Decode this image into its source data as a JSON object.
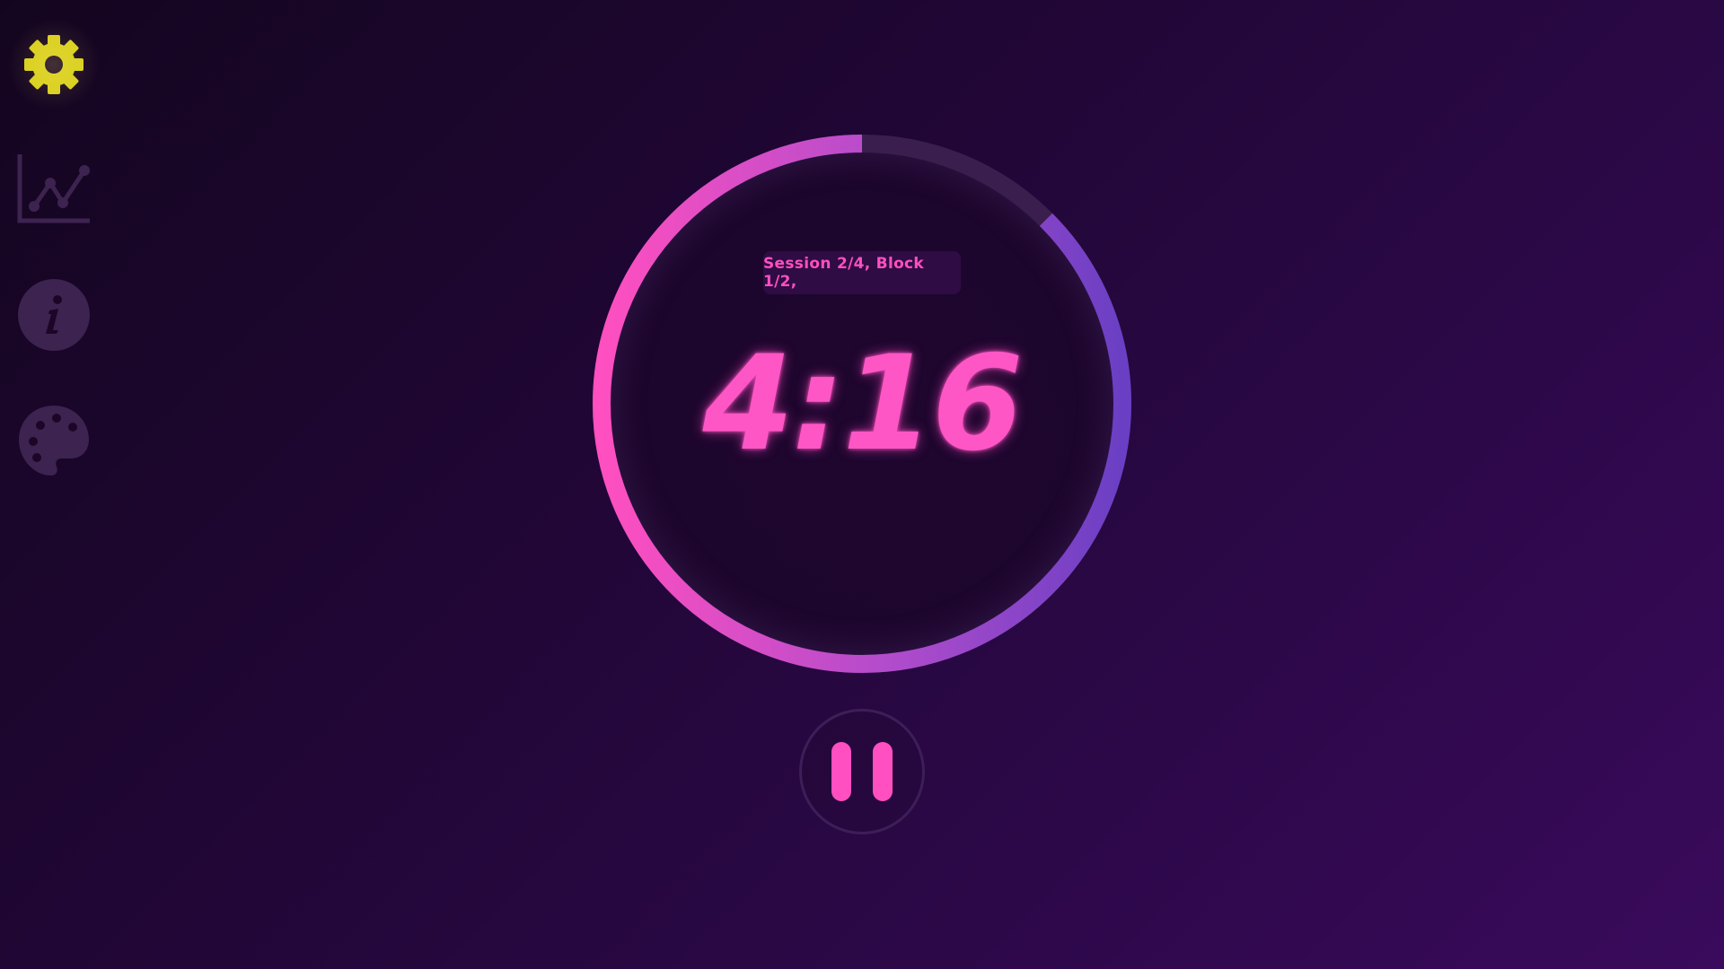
{
  "sidebar": {
    "items": [
      {
        "id": "settings",
        "icon": "gear-icon",
        "color": "#d9cf1f",
        "active": true
      },
      {
        "id": "stats",
        "icon": "line-chart-icon",
        "color": "#3d2350"
      },
      {
        "id": "info",
        "icon": "info-icon",
        "color": "#3d2350"
      },
      {
        "id": "theme",
        "icon": "palette-icon",
        "color": "#3d2350"
      }
    ]
  },
  "timer": {
    "session_label": "Session 2/4, Block 1/2,",
    "time_remaining": "4:16",
    "progress_fraction": 0.875,
    "ring_gradient": [
      "#6a3fc4",
      "#b24ccc",
      "#ff4fc0"
    ],
    "ring_track_color": "#3a1f4e",
    "text_color": "#ff56c6"
  },
  "controls": {
    "pause_icon": "pause-icon",
    "pause_color": "#ff4fc0"
  },
  "theme": {
    "background_start": "#14051f",
    "background_end": "#3a0a5c"
  }
}
